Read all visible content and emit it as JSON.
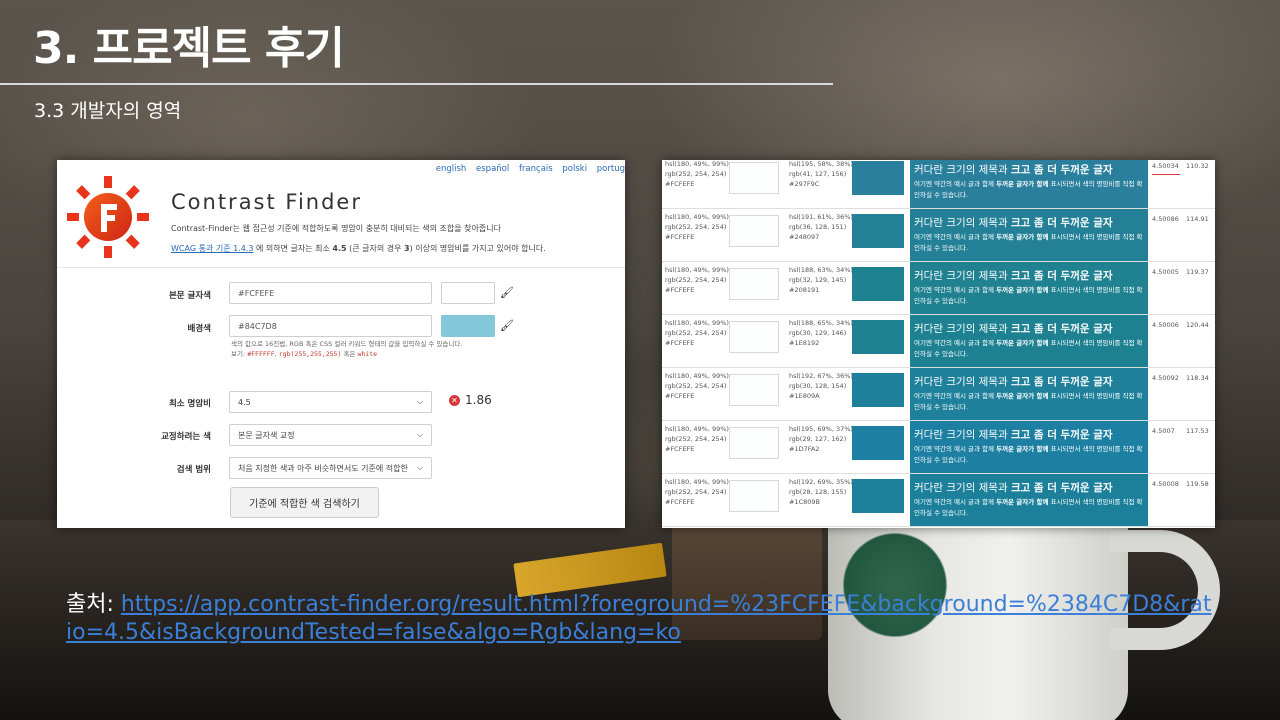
{
  "slide": {
    "title": "3. 프로젝트 후기",
    "subtitle": "3.3  개발자의 영역"
  },
  "contrast_finder": {
    "languages": [
      "english",
      "español",
      "français",
      "polski",
      "portug"
    ],
    "app_name": "Contrast Finder",
    "description": "Contrast-Finder는 웹 접근성 기준에 적합하도록 명암이 충분히 대비되는 색의 조합을 찾아줍니다",
    "wcag_link": "WCAG 통과 기준 1.4.3",
    "wcag_text_pre": " 에 의하면 글자는 최소 ",
    "wcag_bold_1": "4.5",
    "wcag_text_mid": " (큰 글자의 경우 ",
    "wcag_bold_2": "3",
    "wcag_text_post": ") 이상의 명암비를 가지고 있어야 합니다.",
    "fg_label": "본문 글자색",
    "fg_value": "#FCFEFE",
    "bg_label": "배경색",
    "bg_value": "#84C7D8",
    "hint_line1": "색의 값으로 16진법, RGB 혹은 CSS 컬러 키워드 형태의 값을 입력하실 수 있습니다.",
    "hint_prefix": "보기: ",
    "hint_code1": "#FFFFFF",
    "hint_sep": ", ",
    "hint_code2": "rgb(255,255,255)",
    "hint_or": " 혹은 ",
    "hint_code3": "white",
    "min_ratio_label": "최소 명암비",
    "min_ratio_value": "4.5",
    "current_ratio": "1.86",
    "correct_label": "교정하려는 색",
    "correct_value": "본문 글자색 교정",
    "range_label": "검색 범위",
    "range_value": "처음 지정한 색과 아주 비슷하면서도 기준에 적합한",
    "search_button": "기준에 적합한 색 검색하기",
    "colors": {
      "fg": "#FCFEFE",
      "bg": "#84C7D8"
    }
  },
  "results": {
    "preview_big_pre": "커다란 크기의 제목과 ",
    "preview_big_bold": "크고 좀 더 두꺼운 글자",
    "preview_small_pre": "여기엔 약간의 예시 글과 함께 ",
    "preview_small_bold": "두꺼운 글자가 함께",
    "preview_small_post": " 표시되면서 색의 명암비를 직접 확인하실 수 있습니다.",
    "rows": [
      {
        "fg": "hsl(180, 49%, 99%)\nrgb(252, 254, 254)\n#FCFEFE",
        "bg": "hsl(195, 58%, 38%)\nrgb(41, 127, 156)\n#297F9C",
        "color": "#297F9C",
        "ratio": "4.50034",
        "dist": "110.32"
      },
      {
        "fg": "hsl(180, 49%, 99%)\nrgb(252, 254, 254)\n#FCFEFE",
        "bg": "hsl(191, 61%, 36%)\nrgb(36, 128, 151)\n#248097",
        "color": "#248097",
        "ratio": "4.50086",
        "dist": "114.91"
      },
      {
        "fg": "hsl(180, 49%, 99%)\nrgb(252, 254, 254)\n#FCFEFE",
        "bg": "hsl(188, 63%, 34%)\nrgb(32, 129, 145)\n#208191",
        "color": "#208191",
        "ratio": "4.50005",
        "dist": "119.37"
      },
      {
        "fg": "hsl(180, 49%, 99%)\nrgb(252, 254, 254)\n#FCFEFE",
        "bg": "hsl(188, 65%, 34%)\nrgb(30, 129, 146)\n#1E8192",
        "color": "#1E8192",
        "ratio": "4.50006",
        "dist": "120.44"
      },
      {
        "fg": "hsl(180, 49%, 99%)\nrgb(252, 254, 254)\n#FCFEFE",
        "bg": "hsl(192, 67%, 36%)\nrgb(30, 128, 154)\n#1E809A",
        "color": "#1E809A",
        "ratio": "4.50092",
        "dist": "118.34"
      },
      {
        "fg": "hsl(180, 49%, 99%)\nrgb(252, 254, 254)\n#FCFEFE",
        "bg": "hsl(195, 69%, 37%)\nrgb(29, 127, 162)\n#1D7FA2",
        "color": "#1D7FA2",
        "ratio": "4.5007",
        "dist": "117.53"
      },
      {
        "fg": "hsl(180, 49%, 99%)\nrgb(252, 254, 254)\n#FCFEFE",
        "bg": "hsl(192, 69%, 35%)\nrgb(28, 128, 155)\n#1C809B",
        "color": "#1C809B",
        "ratio": "4.50008",
        "dist": "119.58"
      }
    ]
  },
  "source": {
    "label": "출처: ",
    "url": "https://app.contrast-finder.org/result.html?foreground=%23FCFEFE&background=%2384C7D8&ratio=4.5&isBackgroundTested=false&algo=Rgb&lang=ko"
  }
}
